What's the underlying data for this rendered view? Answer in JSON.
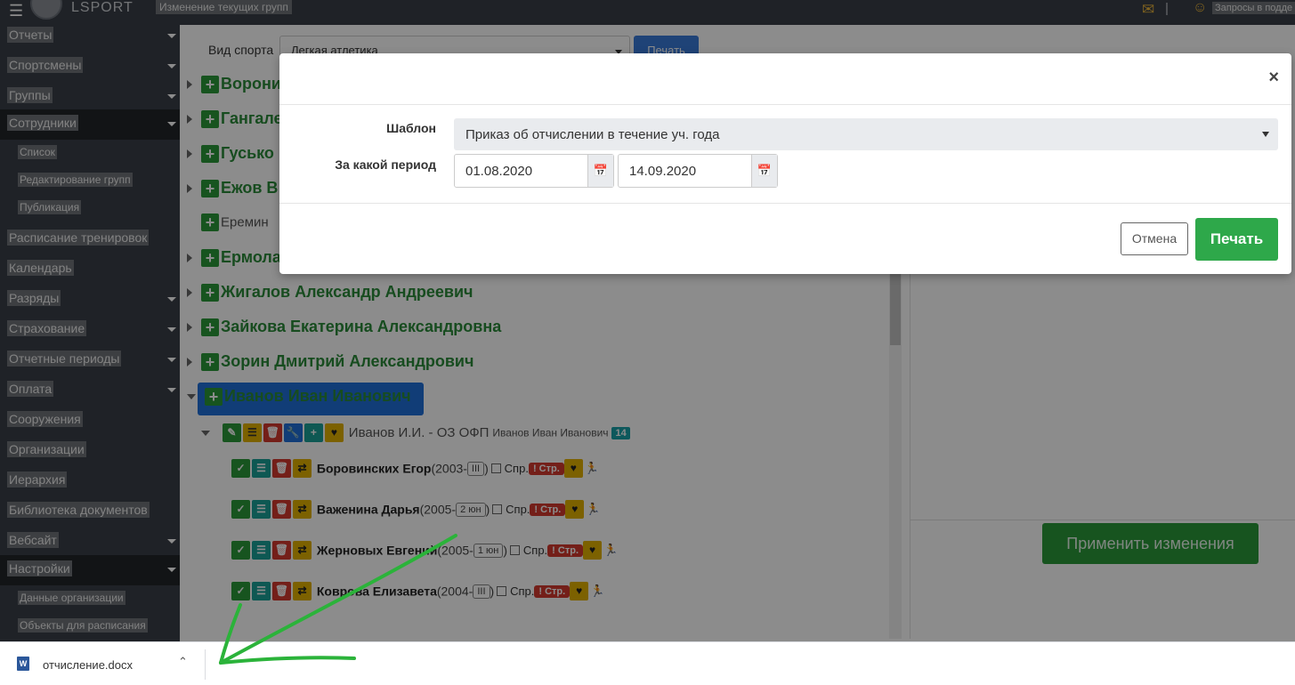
{
  "topbar": {
    "menu_icon": "hamburger-icon",
    "logo_text": "LSPORT",
    "page_title": "Изменение текущих групп",
    "support_text": "Запросы в подде"
  },
  "sidebar": {
    "items": [
      {
        "label": "Отчеты",
        "expandable": true
      },
      {
        "label": "Спортсмены",
        "expandable": true
      },
      {
        "label": "Группы",
        "expandable": true
      },
      {
        "label": "Сотрудники",
        "expandable": true,
        "active": true
      },
      {
        "label": "Список",
        "sub": true
      },
      {
        "label": "Редактирование групп",
        "sub": true
      },
      {
        "label": "Публикация",
        "sub": true
      },
      {
        "label": "Расписание тренировок"
      },
      {
        "label": "Календарь"
      },
      {
        "label": "Разряды",
        "expandable": true
      },
      {
        "label": "Страхование",
        "expandable": true
      },
      {
        "label": "Отчетные периоды",
        "expandable": true
      },
      {
        "label": "Оплата",
        "expandable": true
      },
      {
        "label": "Сооружения"
      },
      {
        "label": "Организации"
      },
      {
        "label": "Иерархия"
      },
      {
        "label": "Библиотека документов"
      },
      {
        "label": "Вебсайт",
        "expandable": true
      },
      {
        "label": "Настройки",
        "expandable": true,
        "active": true
      },
      {
        "label": "Данные организации",
        "sub": true
      },
      {
        "label": "Объекты для расписания",
        "sub": true
      }
    ]
  },
  "main": {
    "sport_label": "Вид спорта",
    "sport_value": "Легкая атлетика",
    "print_label": "Печать",
    "people": [
      {
        "name": "Ворони"
      },
      {
        "name": "Гангале"
      },
      {
        "name": "Гусько"
      },
      {
        "name": "Ежов В"
      },
      {
        "name": "Еремин",
        "plain": true
      },
      {
        "name": "Ермола"
      },
      {
        "name": "Жигалов Александр Андреевич"
      },
      {
        "name": "Зайкова Екатерина Александровна"
      },
      {
        "name": "Зорин Дмитрий Александрович"
      },
      {
        "name": "Иванов Иван Иванович"
      }
    ],
    "group": {
      "title": "Иванов И.И. - ОЗ ОФП",
      "coach": "Иванов Иван Иванович",
      "count": "14"
    },
    "athletes": [
      {
        "name": "Боровинских Егор",
        "year": "(2003-",
        "rank": "III",
        "close": ")"
      },
      {
        "name": "Важенина Дарья",
        "year": "(2005-",
        "rank": "2 юн",
        "close": ")"
      },
      {
        "name": "Жерновых Евгений",
        "year": "(2005-",
        "rank": "1 юн",
        "close": ")"
      },
      {
        "name": "Коврова Елизавета",
        "year": "(2004-",
        "rank": "III",
        "close": ")"
      }
    ],
    "spr_label": "Спр.",
    "str_label": "Стр.",
    "apply_label": "Применить изменения"
  },
  "modal": {
    "template_label": "Шаблон",
    "template_value": "Приказ об отчислении в течение уч. года",
    "period_label": "За какой период",
    "date_from": "01.08.2020",
    "date_to": "14.09.2020",
    "cancel_label": "Отмена",
    "print_label": "Печать",
    "close_icon": "close-icon"
  },
  "download_bar": {
    "file_name": "отчисление.docx",
    "file_icon": "word-document-icon"
  },
  "colors": {
    "sidebar_bg": "#3a3f47",
    "accent_green": "#2ea84a",
    "accent_blue": "#1f6fd9",
    "annotation_arrow": "#2bb33a"
  }
}
